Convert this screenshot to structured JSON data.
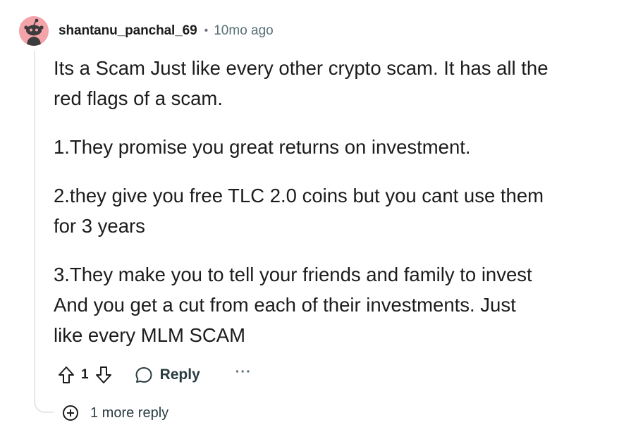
{
  "comment": {
    "author": "shantanu_panchal_69",
    "separator": "•",
    "timestamp": "10mo ago",
    "body": {
      "paragraph_1": {
        "line_1": "Its a Scam Just like every other crypto scam. It has all the",
        "line_2": "red flags of a scam."
      },
      "paragraph_2": {
        "line_1": "1.They promise you great returns on investment."
      },
      "paragraph_3": {
        "line_1": "2.they give you free TLC 2.0 coins but you cant use them",
        "line_2": "for 3 years"
      },
      "paragraph_4": {
        "line_1": "3.They make you to tell your friends and family to invest",
        "line_2": "And you get a cut from each of their investments. Just",
        "line_3": "like every MLM SCAM"
      }
    },
    "actions": {
      "upvote_icon": "arrow-up-outline-icon",
      "vote_count": "1",
      "downvote_icon": "arrow-down-outline-icon",
      "reply_icon": "speech-bubble-icon",
      "reply_label": "Reply",
      "more_label": "···"
    },
    "more_replies": {
      "icon": "plus-circle-icon",
      "label": "1 more reply"
    },
    "colors": {
      "avatar_bg": "#f4a3a8",
      "text_primary": "#1c1c1c",
      "text_secondary": "#576f76",
      "thread_line": "#e5e7eb"
    }
  }
}
